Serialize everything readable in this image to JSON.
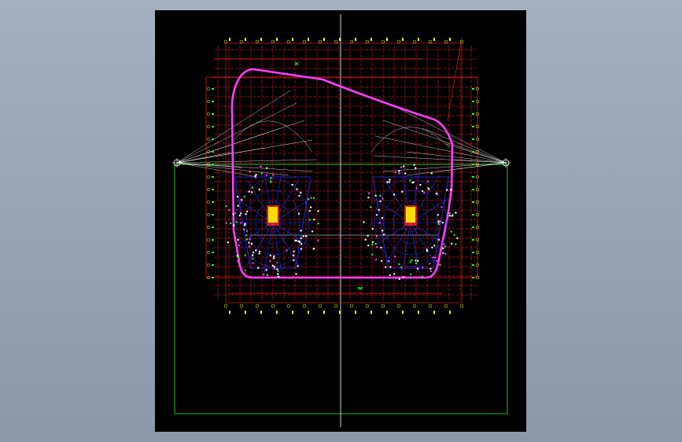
{
  "viewport": {
    "background": "#000000"
  },
  "colors": {
    "grid": "#ff2020",
    "outline": "#ff40ff",
    "structure": "#3030ff",
    "rays": "#ffffff",
    "sheet_border": "#20c020",
    "annotation": "#ffff00",
    "marker": "#20ff20",
    "center_line": "#ffffff"
  },
  "drawing": {
    "left_station_label": "",
    "right_station_label": ""
  }
}
